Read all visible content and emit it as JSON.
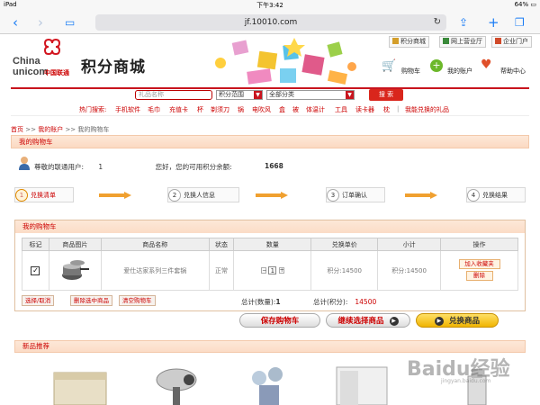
{
  "status_bar": {
    "device": "iPad",
    "time": "下午3:42",
    "battery": "64%"
  },
  "browser": {
    "url": "jf.10010.com"
  },
  "header": {
    "logo_en_line1": "China",
    "logo_en_line2": "unicom",
    "logo_cn": "中国联通",
    "site_name": "积分商城",
    "top_links": [
      "积分商城",
      "网上营业厅",
      "企业门户"
    ],
    "actions": [
      "购物车",
      "我的账户",
      "帮助中心"
    ]
  },
  "search": {
    "placeholder": "礼品名称",
    "range_select": "积分范围",
    "category_select": "全部分类",
    "button": "搜 索",
    "hot_label": "热门搜索:",
    "hot_terms": [
      "手机软件",
      "毛巾",
      "充值卡",
      "杯",
      "剃须刀",
      "锅",
      "电吹风",
      "盒",
      "被",
      "体温计",
      "工具",
      "读卡器",
      "枕"
    ],
    "separator": "|",
    "my_gifts": "我能兑换的礼品"
  },
  "breadcrumb": {
    "home": "首页",
    "sep": ">>",
    "account": "我的账户",
    "current": "我的购物车"
  },
  "page_title": "我的购物车",
  "user": {
    "greeting": "尊敬的联通用户:",
    "phone": "1",
    "points_label": "您好，您的可用积分余额:",
    "points": "1668"
  },
  "steps": [
    {
      "num": "1",
      "label": "兑换清单"
    },
    {
      "num": "2",
      "label": "兑换人信息"
    },
    {
      "num": "3",
      "label": "订单确认"
    },
    {
      "num": "4",
      "label": "兑换结果"
    }
  ],
  "cart": {
    "title": "我的购物车",
    "columns": [
      "标记",
      "商品图片",
      "商品名称",
      "状态",
      "数量",
      "兑换单价",
      "小计",
      "操作"
    ],
    "rows": [
      {
        "name": "爱仕达家系列三件套锅",
        "status": "正常",
        "qty": "1",
        "unit_price": "积分:14500",
        "subtotal": "积分:14500",
        "op_fav": "加入收藏夹",
        "op_del": "删除"
      }
    ],
    "btn_select": "选择/取消",
    "btn_delete_selected": "删除选中商品",
    "btn_clear": "清空购物车",
    "total_qty_label": "总计(数量):",
    "total_qty": "1",
    "total_points_label": "总计(积分):",
    "total_points": "14500",
    "qty_minus": "−",
    "qty_plus": "+"
  },
  "actions": {
    "save_cart": "保存购物车",
    "continue": "继续选择商品",
    "redeem": "兑换商品"
  },
  "recommend_title": "新品推荐",
  "watermark": "Baidu经验",
  "watermark_sub": "jingyan.baidu.com"
}
